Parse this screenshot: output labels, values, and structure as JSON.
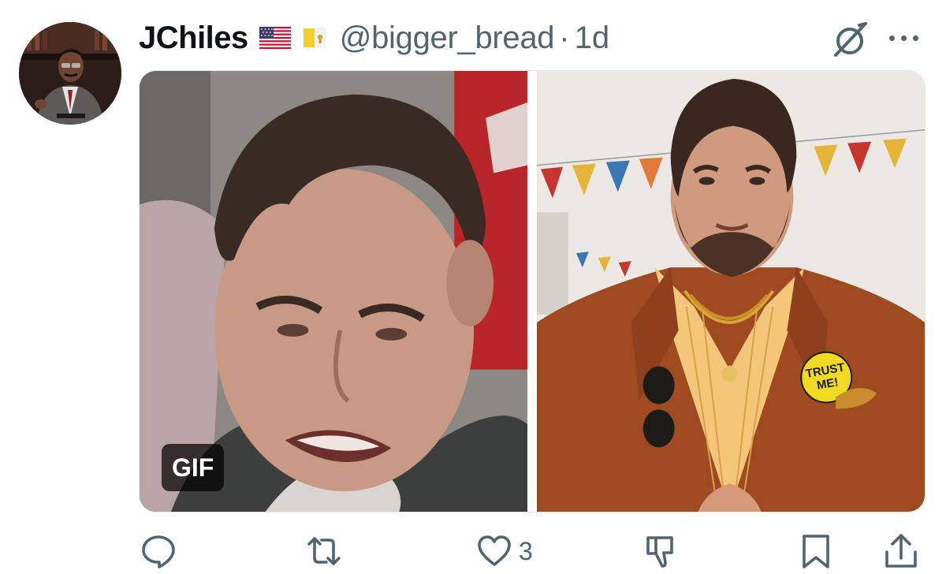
{
  "tweet": {
    "display_name": "JChiles",
    "badges": {
      "flag_1": "flag-us-icon",
      "flag_2": "flag-vatican-icon"
    },
    "handle": "@bigger_bread",
    "separator": "·",
    "time": "1d",
    "media": {
      "left_badge": "GIF",
      "right_button_text": "TRUST\nME!"
    },
    "actions": {
      "like_count": "3"
    }
  },
  "colors": {
    "text_primary": "#0f1419",
    "text_secondary": "#536471",
    "background": "#ffffff"
  }
}
